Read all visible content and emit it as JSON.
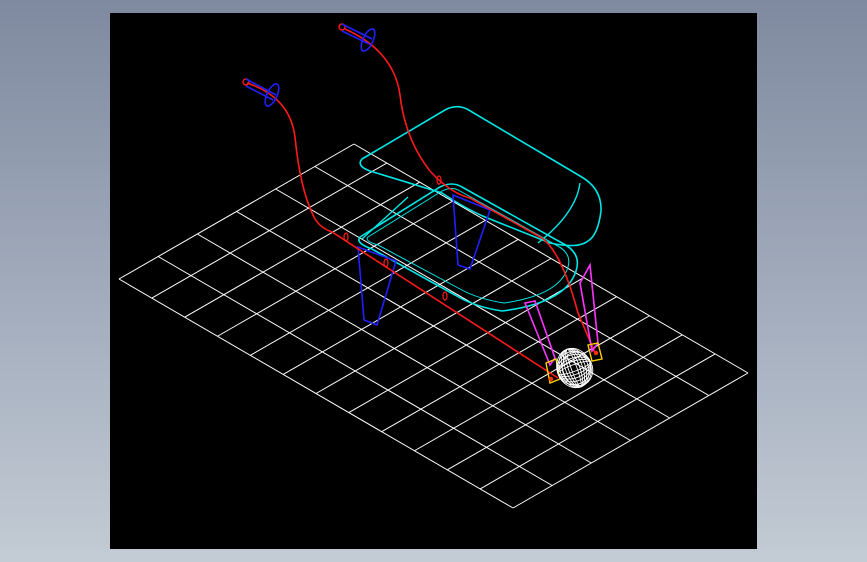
{
  "viewport": {
    "background": "#000000",
    "page_background": "#97a1b3"
  },
  "grid": {
    "color": "#ffffff",
    "rows": 6,
    "cols": 12
  },
  "parts": {
    "handle_frame_color": "#ff1a1a",
    "grip_color": "#2020ff",
    "tray_color": "#00e5e5",
    "leg_color": "#2020ff",
    "strut_color": "#ff33ff",
    "wheel_color": "#ffffff",
    "axle_bracket_color": "#ffd000"
  },
  "icons": {
    "wheel": "wheel-icon",
    "grip": "handle-grip-icon"
  }
}
